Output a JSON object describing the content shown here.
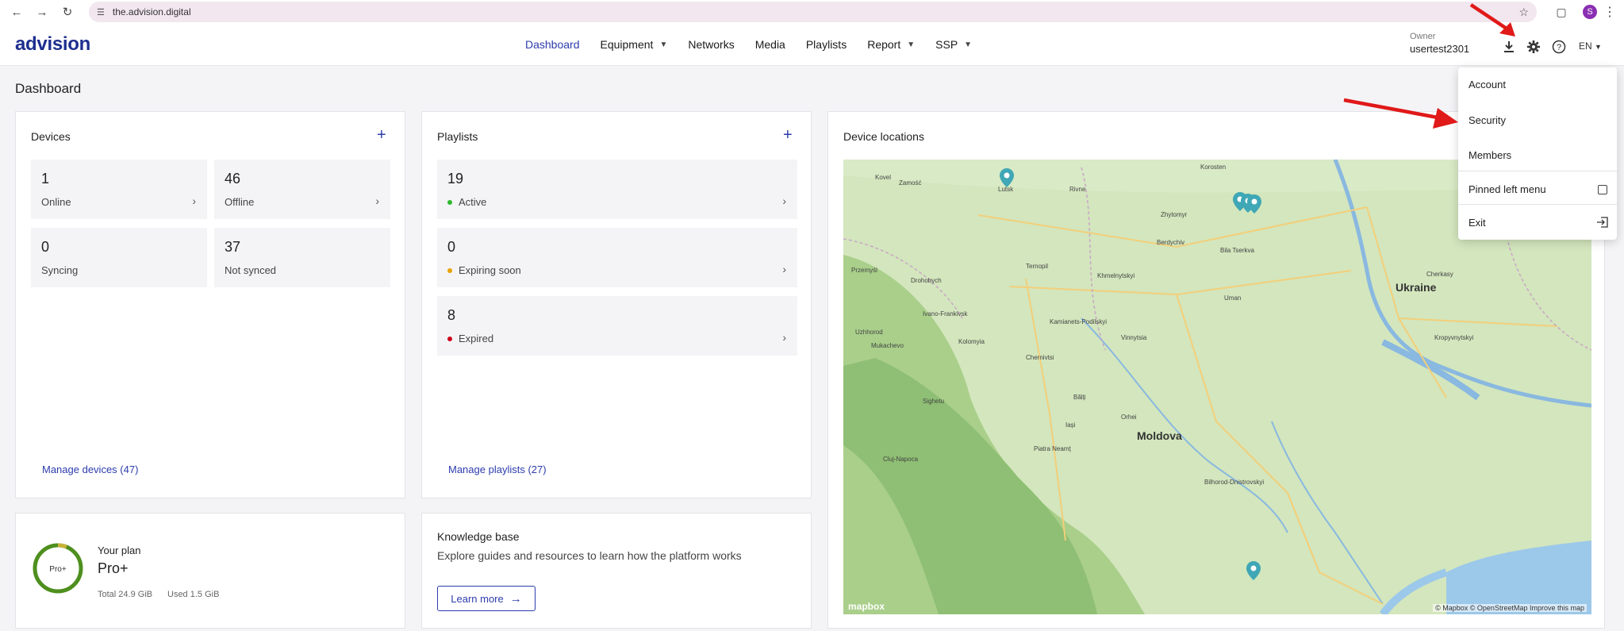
{
  "browser": {
    "url": "the.advision.digital",
    "profile_initial": "S"
  },
  "app": {
    "logo": "advision",
    "nav": [
      {
        "label": "Dashboard",
        "active": true
      },
      {
        "label": "Equipment",
        "dropdown": true
      },
      {
        "label": "Networks"
      },
      {
        "label": "Media"
      },
      {
        "label": "Playlists"
      },
      {
        "label": "Report",
        "dropdown": true
      },
      {
        "label": "SSP",
        "dropdown": true
      }
    ],
    "owner_label": "Owner",
    "owner_name": "usertest2301",
    "language": "EN"
  },
  "page_title": "Dashboard",
  "devices": {
    "title": "Devices",
    "tiles": [
      {
        "value": "1",
        "label": "Online"
      },
      {
        "value": "46",
        "label": "Offline"
      },
      {
        "value": "0",
        "label": "Syncing"
      },
      {
        "value": "37",
        "label": "Not synced"
      }
    ],
    "manage_link": "Manage devices (47)"
  },
  "playlists": {
    "title": "Playlists",
    "tiles": [
      {
        "value": "19",
        "label": "Active",
        "dot_color": "#2eb82e"
      },
      {
        "value": "0",
        "label": "Expiring soon",
        "dot_color": "#e8a200"
      },
      {
        "value": "8",
        "label": "Expired",
        "dot_color": "#d0021b"
      }
    ],
    "manage_link": "Manage playlists (27)"
  },
  "plan": {
    "ring_text": "Pro+",
    "label": "Your plan",
    "name": "Pro+",
    "total": "Total 24.9 GiB",
    "used": "Used 1.5 GiB",
    "used_fraction": 0.06
  },
  "knowledge": {
    "title": "Knowledge base",
    "description": "Explore guides and resources to learn how the platform works",
    "button": "Learn more"
  },
  "map": {
    "title": "Device locations",
    "attribution": "© Mapbox © OpenStreetMap Improve this map",
    "logo": "mapbox",
    "labels": {
      "ukraine": "Ukraine",
      "moldova": "Moldova",
      "rivne": "Rivne",
      "lutsk": "Lutsk",
      "zhytomyr": "Zhytomyr",
      "ternopil": "Ternopil",
      "khmelnytskyi": "Khmelnytskyi",
      "vinnytsia": "Vinnytsia",
      "chernivtsi": "Chernivtsi",
      "uzhhorod": "Uzhhorod",
      "bila_tserkva": "Bila Tserkva",
      "cherkasy": "Cherkasy",
      "kropyvnytskyi": "Kropyvnytskyi",
      "uman": "Uman",
      "balti": "Bălți",
      "cluj": "Cluj-Napoca",
      "iasi": "Iași",
      "berdychiv": "Berdychiv",
      "drohobych": "Drohobych",
      "przemysl": "Przemyśl",
      "zamosc": "Zamość",
      "kovel": "Kovel",
      "korosten": "Korosten",
      "bilhorod": "Bilhorod-Dnistrovskyi",
      "ivano": "Ivano-Frankivsk",
      "kolomyia": "Kolomyia",
      "orhei": "Orhei",
      "podilskyi": "Kamianets-Podilskyi",
      "piatra": "Piatra Neamț",
      "sighetu": "Sighetu",
      "mukachevo": "Mukachevo"
    }
  },
  "dropdown": {
    "items": [
      "Account",
      "Security",
      "Members",
      "Pinned left menu",
      "Exit"
    ]
  },
  "colors": {
    "accent": "#2d3cad",
    "logo": "#1d2f8f",
    "plan_ring": "#4e8f1e",
    "annotation": "#e01919"
  }
}
